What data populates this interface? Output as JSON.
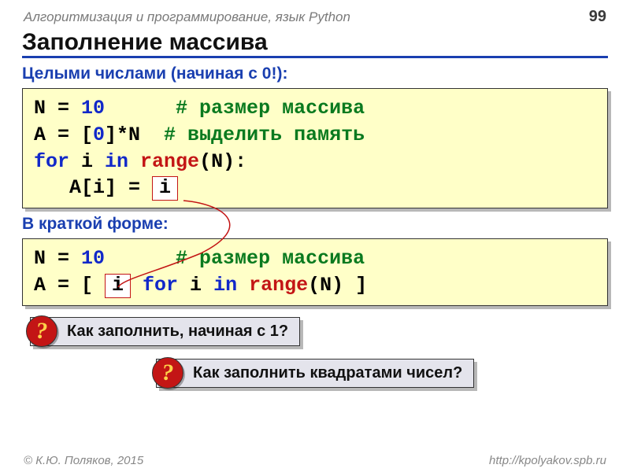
{
  "header": {
    "course": "Алгоритмизация и программирование, язык Python",
    "page_number": "99"
  },
  "title": "Заполнение массива",
  "subtitle1": "Целыми числами (начиная с 0!):",
  "code1": {
    "l1a": "N = ",
    "l1b": "10",
    "l1c": "      # размер массива",
    "l2a": "A = [",
    "l2b": "0",
    "l2c": "]*N  ",
    "l2d": "# выделить память",
    "l3a": "for",
    "l3b": " i ",
    "l3c": "in",
    "l3d": " range",
    "l3e": "(N):",
    "l4a": "   A[i] = ",
    "boxed_i": "i"
  },
  "subtitle2": "В краткой форме:",
  "code2": {
    "l1a": "N = ",
    "l1b": "10",
    "l1c": "      # размер массива",
    "l2a": "A = [ ",
    "boxed_i": "i",
    "l2b": " for",
    "l2c": " i ",
    "l2d": "in",
    "l2e": " range",
    "l2f": "(N) ]"
  },
  "q1": " Как заполнить, начиная с 1?",
  "q2": " Как заполнить квадратами чисел?",
  "qmark": "?",
  "footer": {
    "left": "© К.Ю. Поляков, 2015",
    "right": "http://kpolyakov.spb.ru"
  }
}
